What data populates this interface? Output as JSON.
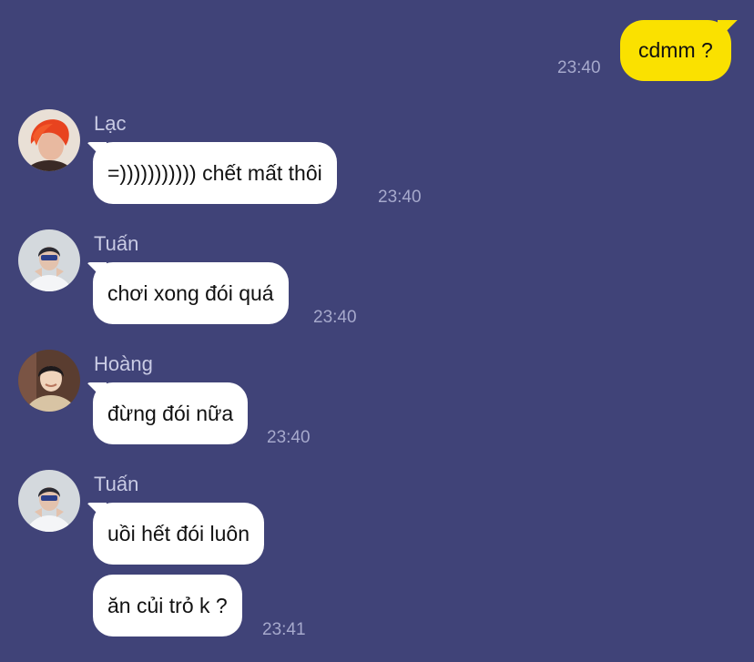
{
  "chat": {
    "messages": [
      {
        "text": "cdmm ?",
        "time": "23:40"
      },
      {
        "sender": "Lạc",
        "text": "=))))))))))) chết mất thôi",
        "time": "23:40"
      },
      {
        "sender": "Tuấn",
        "text": "chơi xong đói quá",
        "time": "23:40"
      },
      {
        "sender": "Hoàng",
        "text": "đừng đói nữa",
        "time": "23:40"
      },
      {
        "sender": "Tuấn",
        "text": "uồi hết đói luôn"
      },
      {
        "text": "ăn củi trỏ k ?",
        "time": "23:41"
      }
    ]
  },
  "colors": {
    "background": "#404378",
    "own_bubble": "#fae100",
    "other_bubble": "#ffffff",
    "timestamp": "#a6a9cc"
  },
  "icons": {
    "lac_avatar": "red-haired-person-photo",
    "tuan_avatar": "person-in-white-shirt-photo",
    "hoang_avatar": "person-in-beige-shirt-photo"
  }
}
